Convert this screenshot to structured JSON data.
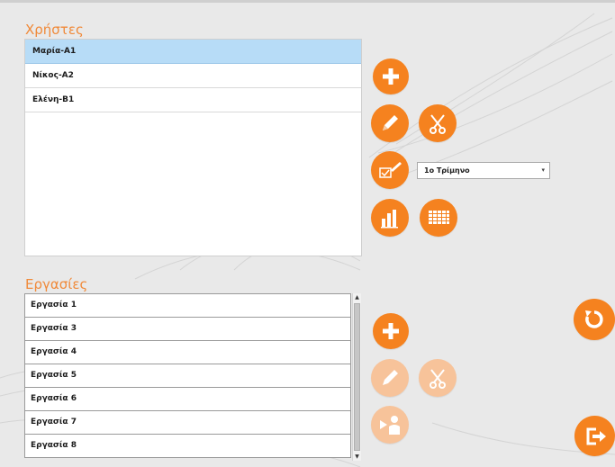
{
  "users": {
    "title": "Χρήστες",
    "items": [
      {
        "label": "Μαρία-Α1",
        "selected": true
      },
      {
        "label": "Νίκος-Α2",
        "selected": false
      },
      {
        "label": "Ελένη-Β1",
        "selected": false
      }
    ]
  },
  "tasks": {
    "title": "Εργασίες",
    "items": [
      {
        "label": "Εργασία 1"
      },
      {
        "label": "Εργασία 3"
      },
      {
        "label": "Εργασία 4"
      },
      {
        "label": "Εργασία 5"
      },
      {
        "label": "Εργασία 6"
      },
      {
        "label": "Εργασία 7"
      },
      {
        "label": "Εργασία 8"
      }
    ]
  },
  "period_select": {
    "value": "1ο Τρίμηνο"
  },
  "icons": {
    "add_user": "plus-icon",
    "edit_user": "pencil-icon",
    "delete_user": "scissors-icon",
    "assign": "checklist-pencil-icon",
    "chart": "bar-chart-icon",
    "calendar": "grid-calendar-icon",
    "add_task": "plus-icon",
    "edit_task": "pencil-icon",
    "delete_task": "scissors-icon",
    "present": "presenter-icon",
    "refresh": "refresh-icon",
    "exit": "exit-icon"
  },
  "colors": {
    "accent": "#f5821f",
    "accent_disabled": "#f7c39a",
    "title": "#f08a3a",
    "selected_row": "#b7dcf7"
  }
}
